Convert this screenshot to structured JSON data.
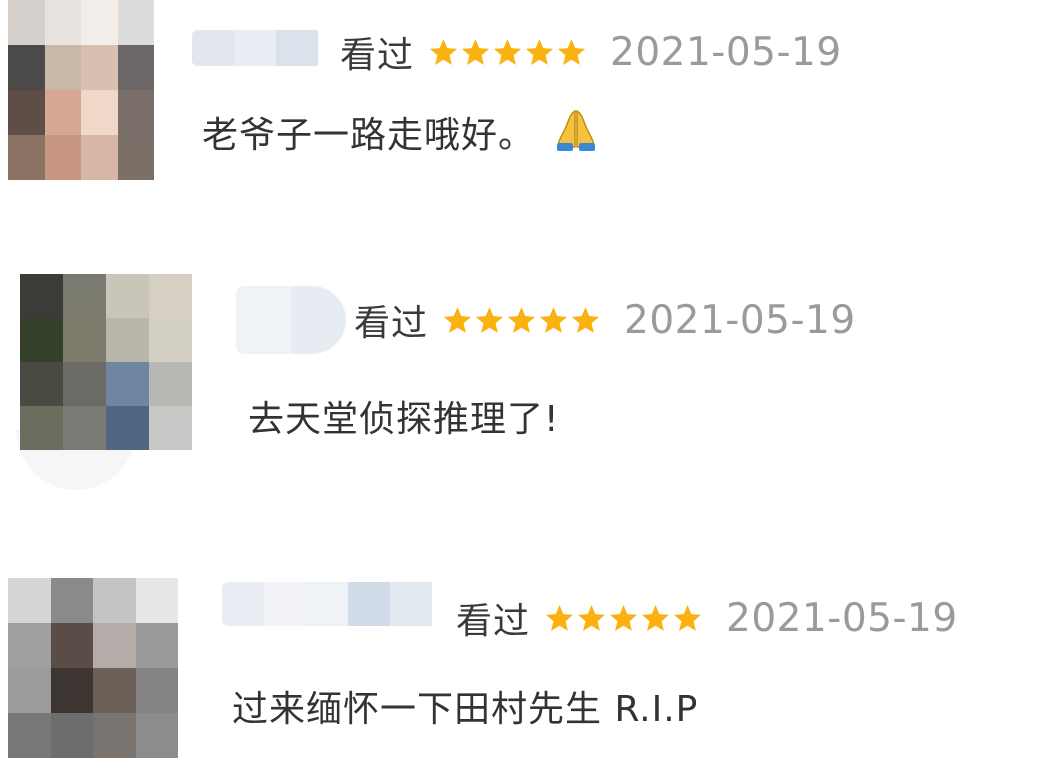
{
  "comments": [
    {
      "status": "看过",
      "stars": 5,
      "date": "2021-05-19",
      "text": "老爷子一路走哦好。",
      "emoji_icon": "folded-hands-icon",
      "avatar_colors": [
        "#d6d0cc",
        "#e9e3df",
        "#f2ede8",
        "#dcdcdc",
        "#4b4a48",
        "#c7b8a8",
        "#d8c0b0",
        "#6b6766",
        "#5f4d47",
        "#d6a995",
        "#efd8c8",
        "#7a6e6a",
        "#8b7262",
        "#c79782",
        "#d8b6a6",
        "#7c6f68"
      ]
    },
    {
      "status": "看过",
      "stars": 5,
      "date": "2021-05-19",
      "text": "去天堂侦探推理了!",
      "avatar_colors": [
        "#3c3b38",
        "#7b7a6f",
        "#c9c5b9",
        "#d6d0c4",
        "#35402b",
        "#7d7b6c",
        "#b8b6a8",
        "#d4cfc3",
        "#4a4a42",
        "#6b6b66",
        "#6f86a0",
        "#b8b8b5",
        "#6b6b5e",
        "#797a74",
        "#4f6780",
        "#c9c9c7"
      ]
    },
    {
      "status": "看过",
      "stars": 5,
      "date": "2021-05-19",
      "text": "过来缅怀一下田村先生 R.I.P",
      "avatar_colors": [
        "#d6d6d6",
        "#8a8a8a",
        "#c4c4c4",
        "#e6e6e6",
        "#a0a0a0",
        "#5a4d48",
        "#b4aca8",
        "#9a9a9a",
        "#9c9c9c",
        "#3c3532",
        "#6b5f58",
        "#848484",
        "#777777",
        "#6d6d6d",
        "#7a7470",
        "#8c8c8c"
      ]
    }
  ],
  "colors": {
    "star": "#fbb20e",
    "date": "#9a9a9a",
    "text": "#333333"
  }
}
